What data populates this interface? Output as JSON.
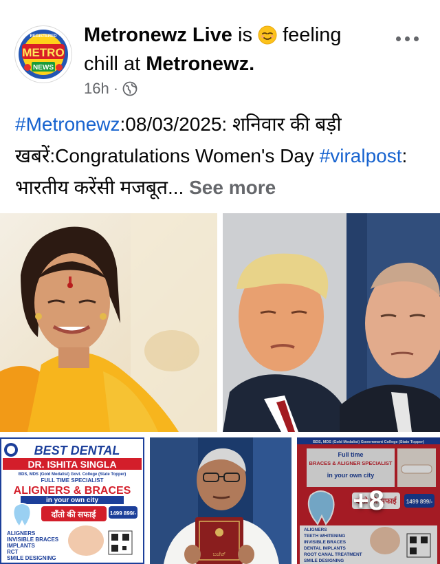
{
  "post": {
    "author": "Metronewz Live",
    "is_text": "is",
    "feeling_text": "feeling",
    "activity": "chill at",
    "place": "Metronewz",
    "period": ".",
    "time": "16h",
    "dot": "·",
    "visibility_icon": "globe-icon",
    "more_icon": "more-options-icon"
  },
  "caption": {
    "hashtag1": "#Metronewz",
    "text1": ":08/03/2025: शनिवार की बड़ी खबरें:Congratulations Women's Day ",
    "hashtag2": "#viralpost",
    "text2": ": भारतीय करेंसी मजबूत...",
    "see_more": "See more"
  },
  "avatar_logo": {
    "top": "METRO",
    "ribbon": "NEWS",
    "upper_arc": "REGISTERED"
  },
  "photos": {
    "overlay": "+8",
    "dental1": {
      "title": "BEST DENTAL",
      "doctor": "DR. ISHITA SINGLA",
      "degree": "BDS, MDS (Gold Medalist) Govt. College (State Topper)",
      "specialist": "FULL TIME SPECIALIST",
      "service": "ALIGNERS & BRACES",
      "sub": "in your own city",
      "offer": "दाँतो की सफाई",
      "price": "1499 899/-",
      "list": [
        "ALIGNERS",
        "INVISIBLE BRACES",
        "IMPLANTS",
        "RCT",
        "SMILE DESIGNING"
      ]
    },
    "dental2": {
      "header": "BDS, MDS (Gold Medalist) Government College (State Topper)",
      "title1": "Full time",
      "title2": "BRACES & ALIGNER SPECIALIST",
      "sub": "in your own city",
      "offer": "दाँतो की सफाई",
      "price": "1499 899/-",
      "list": [
        "ALIGNERS",
        "TEETH WHITENING",
        "INVISIBLE BRACES",
        "DENTAL IMPLANTS",
        "ROOT CANAL TREATMENT",
        "SMILE DESIGNING"
      ]
    },
    "book_text": "ಬಜೆಟ್"
  },
  "colors": {
    "hashtag": "#1763cf",
    "meta": "#65676b",
    "dental_red": "#d31e2a",
    "dental_blue": "#1c3f9a"
  }
}
